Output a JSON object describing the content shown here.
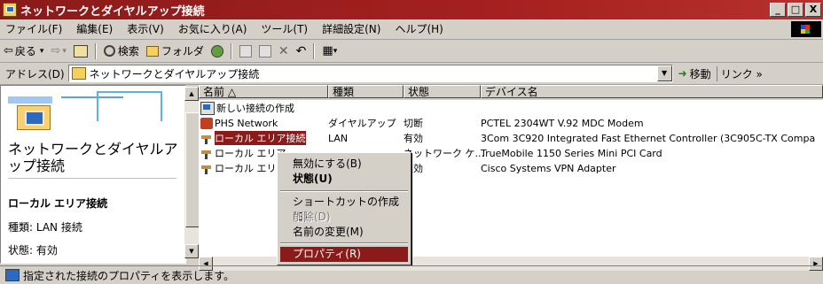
{
  "window": {
    "title": "ネットワークとダイヤルアップ接続",
    "btn_min": "_",
    "btn_max": "□",
    "btn_close": "X"
  },
  "menu": [
    "ファイル(F)",
    "編集(E)",
    "表示(V)",
    "お気に入り(A)",
    "ツール(T)",
    "詳細設定(N)",
    "ヘルプ(H)"
  ],
  "toolbar": {
    "back": "戻る",
    "back_icon": "⇦",
    "forward_icon": "⇨",
    "caret": "▾",
    "search": "検索",
    "folders": "フォルダ",
    "delete_icon": "✕",
    "undo_icon": "↶",
    "views_icon": "▦"
  },
  "address": {
    "label": "アドレス(D)",
    "value": "ネットワークとダイヤルアップ接続",
    "go": "移動",
    "links": "リンク »",
    "dropdown_icon": "▼",
    "go_icon": "➜"
  },
  "left_panel": {
    "title": "ネットワークとダイヤルアップ接続",
    "selected_name": "ローカル エリア接続",
    "type_text": "種類: LAN 接続",
    "state_text": "状態: 有効"
  },
  "list": {
    "headers": [
      "名前 △",
      "種類",
      "状態",
      "デバイス名"
    ],
    "rows": [
      {
        "name": "新しい接続の作成",
        "type": "",
        "state": "",
        "device": "",
        "icon": "new-connection-icon"
      },
      {
        "name": "PHS Network",
        "type": "ダイヤルアップ",
        "state": "切断",
        "device": "PCTEL 2304WT V.92 MDC Modem",
        "icon": "phone-icon"
      },
      {
        "name": "ローカル エリア接続",
        "type": "LAN",
        "state": "有効",
        "device": "3Com 3C920 Integrated Fast Ethernet Controller (3C905C-TX Compa",
        "icon": "lan-icon"
      },
      {
        "name": "ローカル エリア",
        "type": "",
        "state": "ネットワーク ケ...",
        "device": "TrueMobile 1150 Series Mini PCI Card",
        "icon": "lan-icon"
      },
      {
        "name": "ローカル エリア",
        "type": "",
        "state": "無効",
        "device": "Cisco Systems VPN Adapter",
        "icon": "lan-icon"
      }
    ]
  },
  "context_menu": {
    "disable": "無効にする(B)",
    "status": "状態(U)",
    "shortcut": "ショートカットの作成(S)",
    "delete": "削除(D)",
    "rename": "名前の変更(M)",
    "properties": "プロパティ(R)"
  },
  "scroll": {
    "up": "▲",
    "down": "▼",
    "left": "◀",
    "right": "▶"
  },
  "statusbar": {
    "text": "指定された接続のプロパティを表示します。"
  },
  "colors": {
    "selection": "#8b1a1a",
    "chrome": "#d4d0c8"
  }
}
